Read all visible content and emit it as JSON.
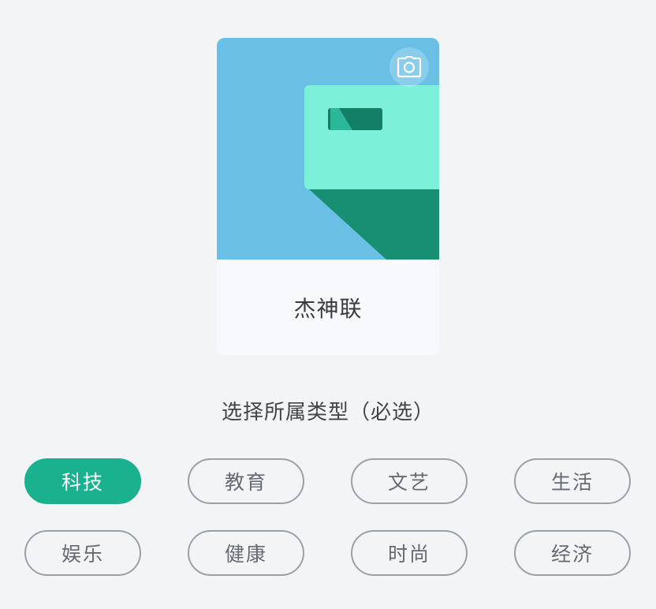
{
  "card": {
    "name": "杰神联",
    "camera_icon": "camera-icon",
    "cover_colors": {
      "sky": "#6abfe4",
      "panel": "#7cf0d8",
      "shadow": "#168f73",
      "slot": "#137f66",
      "slot_light": "#2bb79a"
    }
  },
  "category": {
    "label": "选择所属类型（必选）",
    "options": [
      "科技",
      "教育",
      "文艺",
      "生活",
      "娱乐",
      "健康",
      "时尚",
      "经济"
    ],
    "selected": "科技"
  },
  "colors": {
    "accent": "#1ab28e",
    "chip_border": "#9aa0a6",
    "chip_text": "#666a70",
    "background": "#f3f4f6"
  }
}
